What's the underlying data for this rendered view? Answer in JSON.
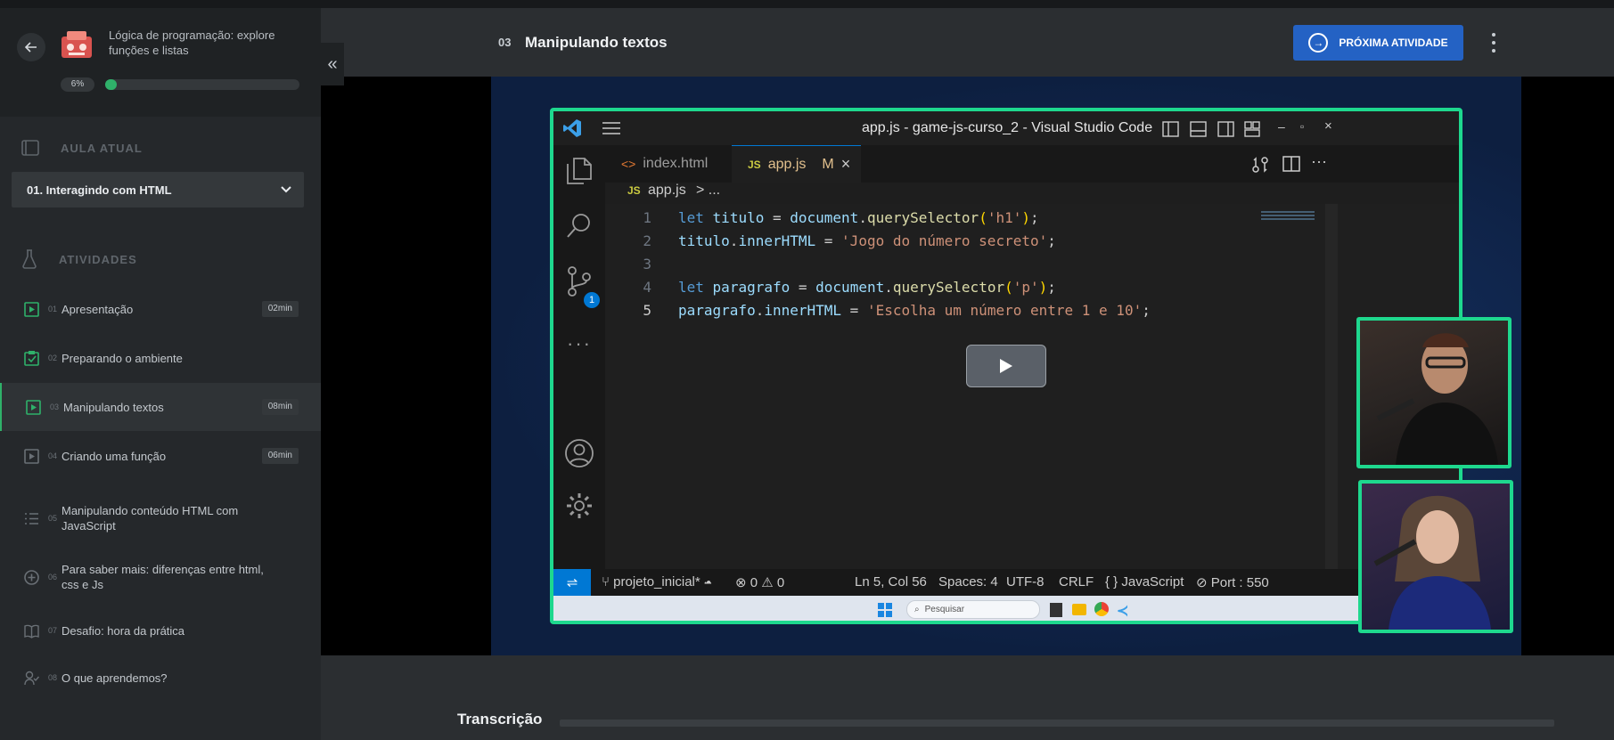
{
  "course": {
    "title": "Lógica de programação: explore funções e listas",
    "progress_label": "6%",
    "progress_value": 0.06
  },
  "sections": {
    "current_label": "AULA ATUAL",
    "activities_label": "ATIVIDADES"
  },
  "lesson_select": {
    "value": "01. Interagindo com HTML"
  },
  "activities": [
    {
      "num": "01",
      "name": "Apresentação",
      "duration": "02min",
      "icon": "video-icon"
    },
    {
      "num": "02",
      "name": "Preparando o ambiente",
      "duration": "",
      "icon": "checklist-icon"
    },
    {
      "num": "03",
      "name": "Manipulando textos",
      "duration": "08min",
      "icon": "video-icon"
    },
    {
      "num": "04",
      "name": "Criando uma função",
      "duration": "06min",
      "icon": "video-icon"
    },
    {
      "num": "05",
      "name": "Manipulando conteúdo HTML com JavaScript",
      "duration": "",
      "icon": "list-icon"
    },
    {
      "num": "06",
      "name": "Para saber mais: diferenças entre html, css e Js",
      "duration": "",
      "icon": "plus-circle-icon"
    },
    {
      "num": "07",
      "name": "Desafio: hora da prática",
      "duration": "",
      "icon": "book-icon"
    },
    {
      "num": "08",
      "name": "O que aprendemos?",
      "duration": "",
      "icon": "user-check-icon"
    }
  ],
  "header": {
    "lesson_num": "03",
    "lesson_title": "Manipulando textos",
    "next_button": "PRÓXIMA ATIVIDADE"
  },
  "vscode": {
    "window_title": "app.js - game-js-curso_2 - Visual Studio Code",
    "tabs": [
      {
        "icon": "<>",
        "label": "index.html"
      },
      {
        "icon": "JS",
        "label": "app.js",
        "badge": "M"
      }
    ],
    "breadcrumb_file": "app.js",
    "breadcrumb_rest": "> ...",
    "code_lines": [
      "let titulo = document.querySelector('h1');",
      "titulo.innerHTML = 'Jogo do número secreto';",
      "",
      "let paragrafo = document.querySelector('p');",
      "paragrafo.innerHTML = 'Escolha um número entre 1 e 10';"
    ],
    "line_numbers": [
      "1",
      "2",
      "3",
      "4",
      "5"
    ],
    "scm_badge": "1",
    "status": {
      "branch": "projeto_inicial*",
      "problems": "⊗ 0 ⚠ 0",
      "position": "Ln 5, Col 56",
      "spaces": "Spaces: 4",
      "encoding": "UTF-8",
      "eol": "CRLF",
      "language": "{ } JavaScript",
      "port": "⊘ Port : 550"
    },
    "taskbar_search": "Pesquisar"
  },
  "transcript": {
    "title": "Transcrição"
  },
  "colors": {
    "accent_green": "#2fb16a",
    "next_button_blue": "#2462c4",
    "camera_border": "#1ed88e"
  }
}
